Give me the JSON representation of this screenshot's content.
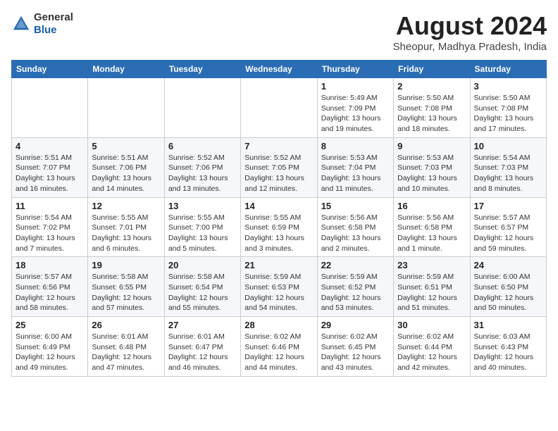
{
  "header": {
    "logo_line1": "General",
    "logo_line2": "Blue",
    "month_year": "August 2024",
    "location": "Sheopur, Madhya Pradesh, India"
  },
  "days_of_week": [
    "Sunday",
    "Monday",
    "Tuesday",
    "Wednesday",
    "Thursday",
    "Friday",
    "Saturday"
  ],
  "weeks": [
    [
      {
        "day": "",
        "info": ""
      },
      {
        "day": "",
        "info": ""
      },
      {
        "day": "",
        "info": ""
      },
      {
        "day": "",
        "info": ""
      },
      {
        "day": "1",
        "info": "Sunrise: 5:49 AM\nSunset: 7:09 PM\nDaylight: 13 hours\nand 19 minutes."
      },
      {
        "day": "2",
        "info": "Sunrise: 5:50 AM\nSunset: 7:08 PM\nDaylight: 13 hours\nand 18 minutes."
      },
      {
        "day": "3",
        "info": "Sunrise: 5:50 AM\nSunset: 7:08 PM\nDaylight: 13 hours\nand 17 minutes."
      }
    ],
    [
      {
        "day": "4",
        "info": "Sunrise: 5:51 AM\nSunset: 7:07 PM\nDaylight: 13 hours\nand 16 minutes."
      },
      {
        "day": "5",
        "info": "Sunrise: 5:51 AM\nSunset: 7:06 PM\nDaylight: 13 hours\nand 14 minutes."
      },
      {
        "day": "6",
        "info": "Sunrise: 5:52 AM\nSunset: 7:06 PM\nDaylight: 13 hours\nand 13 minutes."
      },
      {
        "day": "7",
        "info": "Sunrise: 5:52 AM\nSunset: 7:05 PM\nDaylight: 13 hours\nand 12 minutes."
      },
      {
        "day": "8",
        "info": "Sunrise: 5:53 AM\nSunset: 7:04 PM\nDaylight: 13 hours\nand 11 minutes."
      },
      {
        "day": "9",
        "info": "Sunrise: 5:53 AM\nSunset: 7:03 PM\nDaylight: 13 hours\nand 10 minutes."
      },
      {
        "day": "10",
        "info": "Sunrise: 5:54 AM\nSunset: 7:03 PM\nDaylight: 13 hours\nand 8 minutes."
      }
    ],
    [
      {
        "day": "11",
        "info": "Sunrise: 5:54 AM\nSunset: 7:02 PM\nDaylight: 13 hours\nand 7 minutes."
      },
      {
        "day": "12",
        "info": "Sunrise: 5:55 AM\nSunset: 7:01 PM\nDaylight: 13 hours\nand 6 minutes."
      },
      {
        "day": "13",
        "info": "Sunrise: 5:55 AM\nSunset: 7:00 PM\nDaylight: 13 hours\nand 5 minutes."
      },
      {
        "day": "14",
        "info": "Sunrise: 5:55 AM\nSunset: 6:59 PM\nDaylight: 13 hours\nand 3 minutes."
      },
      {
        "day": "15",
        "info": "Sunrise: 5:56 AM\nSunset: 6:58 PM\nDaylight: 13 hours\nand 2 minutes."
      },
      {
        "day": "16",
        "info": "Sunrise: 5:56 AM\nSunset: 6:58 PM\nDaylight: 13 hours\nand 1 minute."
      },
      {
        "day": "17",
        "info": "Sunrise: 5:57 AM\nSunset: 6:57 PM\nDaylight: 12 hours\nand 59 minutes."
      }
    ],
    [
      {
        "day": "18",
        "info": "Sunrise: 5:57 AM\nSunset: 6:56 PM\nDaylight: 12 hours\nand 58 minutes."
      },
      {
        "day": "19",
        "info": "Sunrise: 5:58 AM\nSunset: 6:55 PM\nDaylight: 12 hours\nand 57 minutes."
      },
      {
        "day": "20",
        "info": "Sunrise: 5:58 AM\nSunset: 6:54 PM\nDaylight: 12 hours\nand 55 minutes."
      },
      {
        "day": "21",
        "info": "Sunrise: 5:59 AM\nSunset: 6:53 PM\nDaylight: 12 hours\nand 54 minutes."
      },
      {
        "day": "22",
        "info": "Sunrise: 5:59 AM\nSunset: 6:52 PM\nDaylight: 12 hours\nand 53 minutes."
      },
      {
        "day": "23",
        "info": "Sunrise: 5:59 AM\nSunset: 6:51 PM\nDaylight: 12 hours\nand 51 minutes."
      },
      {
        "day": "24",
        "info": "Sunrise: 6:00 AM\nSunset: 6:50 PM\nDaylight: 12 hours\nand 50 minutes."
      }
    ],
    [
      {
        "day": "25",
        "info": "Sunrise: 6:00 AM\nSunset: 6:49 PM\nDaylight: 12 hours\nand 49 minutes."
      },
      {
        "day": "26",
        "info": "Sunrise: 6:01 AM\nSunset: 6:48 PM\nDaylight: 12 hours\nand 47 minutes."
      },
      {
        "day": "27",
        "info": "Sunrise: 6:01 AM\nSunset: 6:47 PM\nDaylight: 12 hours\nand 46 minutes."
      },
      {
        "day": "28",
        "info": "Sunrise: 6:02 AM\nSunset: 6:46 PM\nDaylight: 12 hours\nand 44 minutes."
      },
      {
        "day": "29",
        "info": "Sunrise: 6:02 AM\nSunset: 6:45 PM\nDaylight: 12 hours\nand 43 minutes."
      },
      {
        "day": "30",
        "info": "Sunrise: 6:02 AM\nSunset: 6:44 PM\nDaylight: 12 hours\nand 42 minutes."
      },
      {
        "day": "31",
        "info": "Sunrise: 6:03 AM\nSunset: 6:43 PM\nDaylight: 12 hours\nand 40 minutes."
      }
    ]
  ]
}
